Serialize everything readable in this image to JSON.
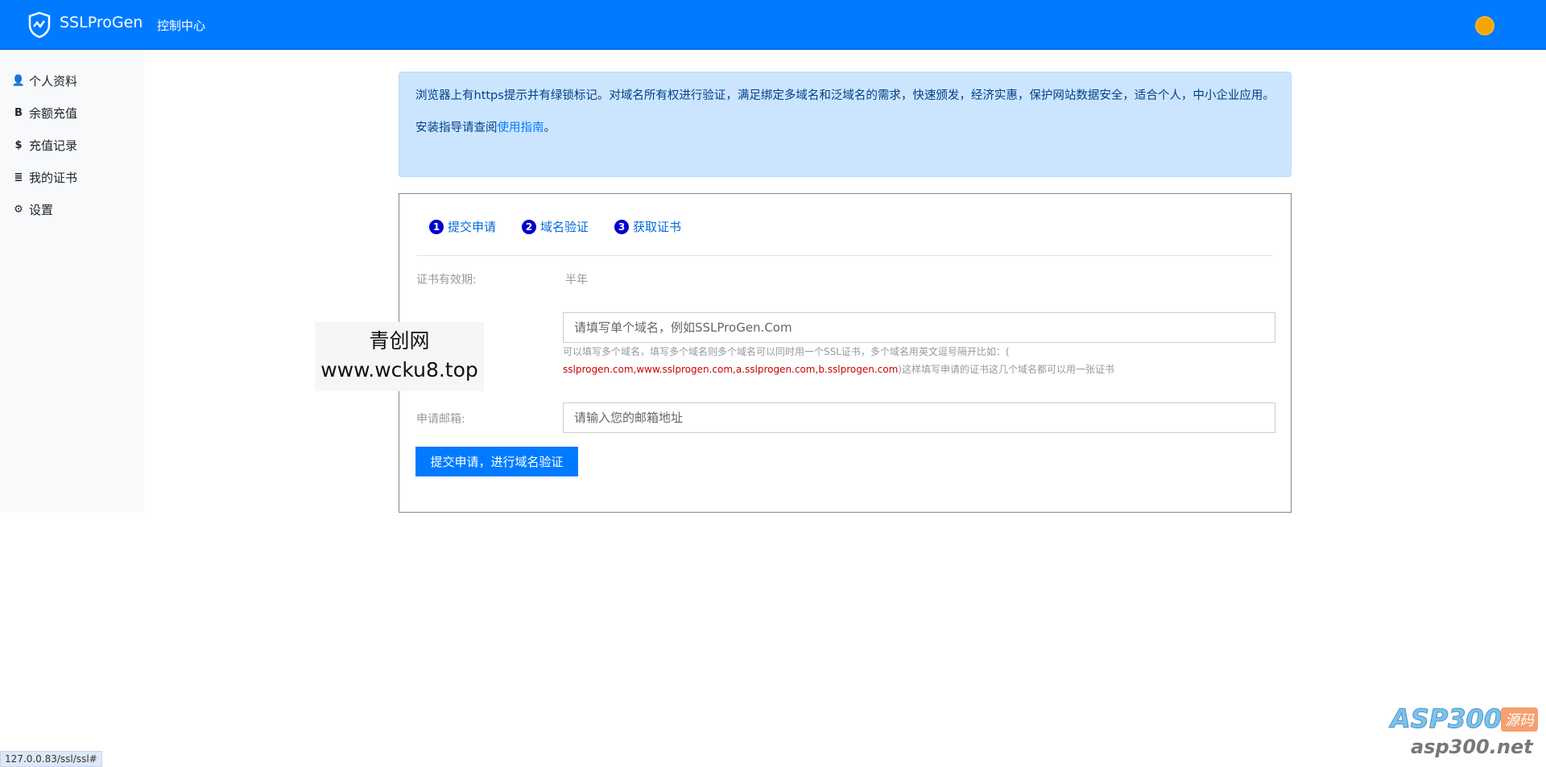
{
  "header": {
    "brand": "SSLProGen",
    "nav": "控制中心",
    "colors": {
      "primary": "#007bff"
    }
  },
  "sidebar": {
    "items": [
      {
        "label": "个人资料",
        "icon": "user-plus-icon"
      },
      {
        "label": "余额充值",
        "icon": "bitcoin-icon"
      },
      {
        "label": "充值记录",
        "icon": "coins-icon"
      },
      {
        "label": "我的证书",
        "icon": "database-icon"
      },
      {
        "label": "设置",
        "icon": "gear-icon"
      }
    ]
  },
  "alert": {
    "line1": "浏览器上有https提示并有绿锁标记。对域名所有权进行验证，满足绑定多域名和泛域名的需求，快速颁发，经济实惠，保护网站数据安全，适合个人，中小企业应用。",
    "line2_prefix": "安装指导请查阅",
    "line2_link": "使用指南",
    "line2_suffix": "。"
  },
  "steps": [
    {
      "num": "1",
      "label": "提交申请"
    },
    {
      "num": "2",
      "label": "域名验证"
    },
    {
      "num": "3",
      "label": "获取证书"
    }
  ],
  "form": {
    "validity_label": "证书有效期:",
    "validity_value": "半年",
    "domain_placeholder": "请填写单个域名，例如SSLProGen.Com",
    "help_line1": "可以填写多个域名，填写多个域名则多个域名可以同时用一个SSL证书，多个域名用英文逗号隔开比如：(",
    "help_example": "sslprogen.com,www.sslprogen.com,a.sslprogen.com,b.sslprogen.com",
    "help_suffix": ")这样填写申请的证书这几个域名都可以用一张证书",
    "email_label": "申请邮箱:",
    "email_placeholder": "请输入您的邮箱地址",
    "submit": "提交申请，进行域名验证"
  },
  "watermark": {
    "line1": "青创网",
    "line2": "www.wcku8.top"
  },
  "corner_logo": {
    "text1": "ASP300",
    "text2": "源码",
    "text3": "asp300.net"
  },
  "status_bar": "127.0.0.83/ssl/ssl#"
}
